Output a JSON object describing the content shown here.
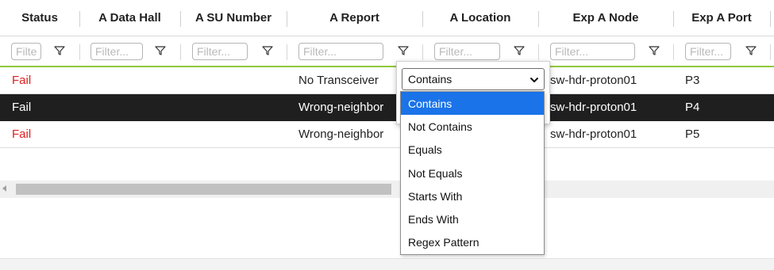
{
  "columns": [
    {
      "label": "Status"
    },
    {
      "label": "A Data Hall"
    },
    {
      "label": "A SU Number"
    },
    {
      "label": "A Report"
    },
    {
      "label": "A Location"
    },
    {
      "label": "Exp A Node"
    },
    {
      "label": "Exp A Port"
    }
  ],
  "filter": {
    "placeholder_short": "Filte",
    "placeholder": "Filter..."
  },
  "rows": [
    {
      "status": "Fail",
      "data_hall": "",
      "su_number": "",
      "report": "No Transceiver",
      "location": "",
      "node": "sw-hdr-proton01",
      "port": "P3",
      "selected": false
    },
    {
      "status": "Fail",
      "data_hall": "",
      "su_number": "",
      "report": "Wrong-neighbor",
      "location": "",
      "node": "sw-hdr-proton01",
      "port": "P4",
      "selected": true
    },
    {
      "status": "Fail",
      "data_hall": "",
      "su_number": "",
      "report": "Wrong-neighbor",
      "location": "",
      "node": "sw-hdr-proton01",
      "port": "P5",
      "selected": false
    }
  ],
  "filter_popup": {
    "selected": "Contains",
    "options": [
      "Contains",
      "Not Contains",
      "Equals",
      "Not Equals",
      "Starts With",
      "Ends With",
      "Regex Pattern"
    ],
    "active_option": "Contains"
  },
  "colors": {
    "fail": "#e02020",
    "selected_row_bg": "#1f1f1f",
    "filter_row_border": "#8fc93a",
    "active_option_bg": "#1a73e8"
  },
  "icons": {
    "filter": "funnel-icon",
    "dropdown": "chevron-down-icon",
    "scroll_left": "left-arrow-icon"
  }
}
